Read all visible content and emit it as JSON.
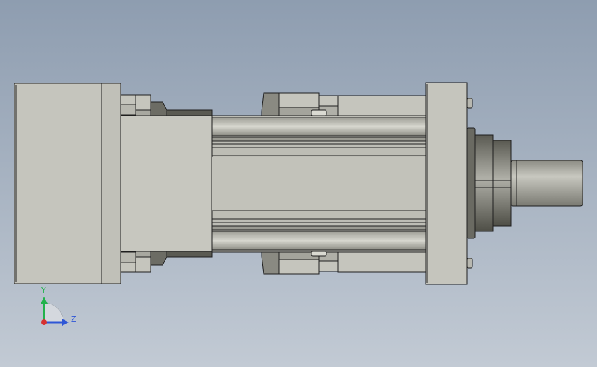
{
  "viewport": {
    "background_top": "#8e9db0",
    "background_bottom": "#c2cad4"
  },
  "model": {
    "body_fill": "#c5c5bd",
    "body_mid_fill": "#bdbdb5",
    "body_dark_fill": "#6c6c64",
    "edge_color": "#1e1e1e",
    "shaft_fill": "#b5b5ad"
  },
  "triad": {
    "y_label": "Y",
    "z_label": "Z",
    "y_color": "#22b24c",
    "z_color": "#2e56d6",
    "x_color": "#d63030",
    "y_icon": "y-axis-arrow",
    "z_icon": "z-axis-arrow"
  }
}
